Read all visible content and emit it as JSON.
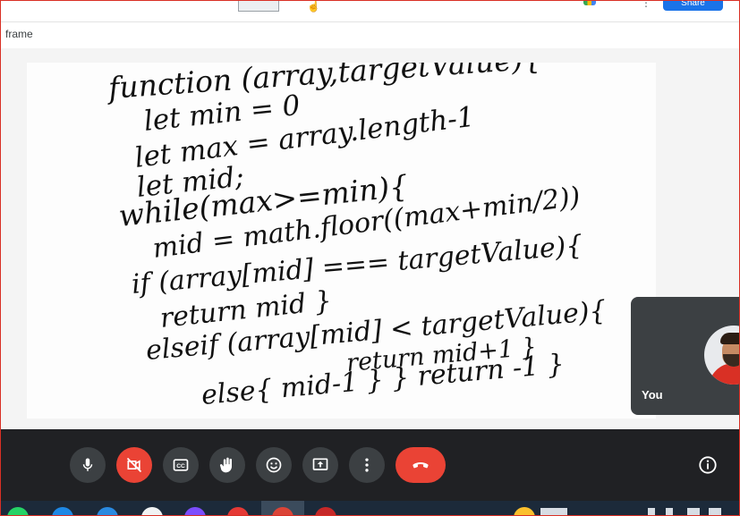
{
  "app": {
    "share_label": "Share",
    "document_label": "frame"
  },
  "handwriting": [
    "function (array,targetValue){",
    "let min = 0",
    "let max = array.length-1",
    "let mid;",
    "while(max>=min){",
    "mid = math.floor((max+min/2))",
    "if (array[mid] === targetValue){",
    "return mid }",
    "elseif (array[mid] < targetValue){",
    "return mid+1 }",
    "else{ mid-1 }  } return -1 }"
  ],
  "self_view": {
    "name": "You"
  },
  "controls": [
    {
      "name": "microphone-button",
      "icon": "mic-icon"
    },
    {
      "name": "camera-off-button",
      "icon": "videocam-off-icon"
    },
    {
      "name": "captions-button",
      "icon": "closed-caption-icon"
    },
    {
      "name": "raise-hand-button",
      "icon": "hand-icon"
    },
    {
      "name": "reactions-button",
      "icon": "emoji-icon"
    },
    {
      "name": "present-button",
      "icon": "present-icon"
    },
    {
      "name": "more-options-button",
      "icon": "more-vert-icon"
    },
    {
      "name": "leave-call-button",
      "icon": "call-end-icon"
    },
    {
      "name": "meeting-details-button",
      "icon": "info-icon"
    }
  ],
  "colors": {
    "accent": "#1a73e8",
    "danger": "#ea4335",
    "control_bar": "#202124",
    "button": "#3c4043",
    "border": "#d93025"
  }
}
